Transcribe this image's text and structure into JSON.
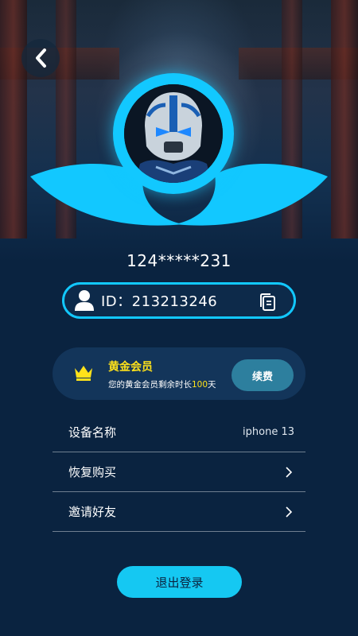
{
  "header": {
    "back_icon": "chevron-left-icon"
  },
  "profile": {
    "phone_masked": "124*****231",
    "id_label": "ID：213213246",
    "avatar_icon": "robot-avatar",
    "user_icon": "user-icon",
    "copy_icon": "copy-icon"
  },
  "vip": {
    "title": "黄金会员",
    "subtitle_prefix": "您的黄金会员剩余时长",
    "days": "100",
    "subtitle_suffix": "天",
    "renew_label": "续费",
    "crown_icon": "crown-icon"
  },
  "settings": {
    "device_label": "设备名称",
    "device_value": "iphone 13",
    "restore_label": "恢复购买",
    "invite_label": "邀请好友"
  },
  "logout_label": "退出登录",
  "colors": {
    "background": "#0a2340",
    "accent_cyan": "#12c8ff",
    "gold": "#ffe21a",
    "card": "#13355a",
    "renew": "#2d7f9e"
  }
}
